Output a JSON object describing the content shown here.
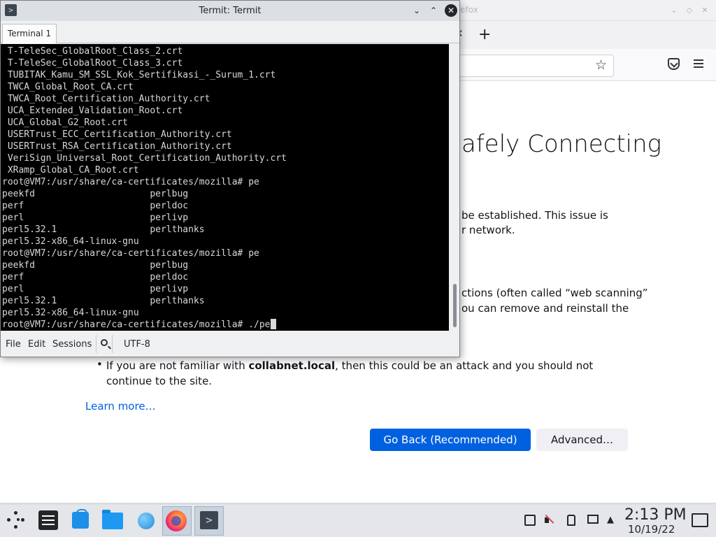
{
  "firefox": {
    "title_fragment": "efox",
    "error": {
      "title_fragment": "afely Connecting",
      "line1_fragment": "be established. This issue is",
      "line2_fragment": "r network.",
      "line3_fragment": "ctions (often called “web scanning”",
      "line4_fragment": "ou can remove and reinstall the",
      "bullet": "•",
      "bullet_pre": "If you are not familiar with ",
      "bullet_bold": "collabnet.local",
      "bullet_post": ", then this could be an attack and you should not continue to the site.",
      "learn_more": "Learn more…",
      "go_back": "Go Back (Recommended)",
      "advanced": "Advanced…"
    }
  },
  "termit": {
    "title": "Termit: Termit",
    "tab": "Terminal 1",
    "lines": [
      " T-TeleSec_GlobalRoot_Class_2.crt",
      " T-TeleSec_GlobalRoot_Class_3.crt",
      " TUBITAK_Kamu_SM_SSL_Kok_Sertifikasi_-_Surum_1.crt",
      " TWCA_Global_Root_CA.crt",
      " TWCA_Root_Certification_Authority.crt",
      " UCA_Extended_Validation_Root.crt",
      " UCA_Global_G2_Root.crt",
      " USERTrust_ECC_Certification_Authority.crt",
      " USERTrust_RSA_Certification_Authority.crt",
      " VeriSign_Universal_Root_Certification_Authority.crt",
      " XRamp_Global_CA_Root.crt",
      "root@VM7:/usr/share/ca-certificates/mozilla# pe",
      "peekfd                     perlbug",
      "perf                       perldoc",
      "perl                       perlivp",
      "perl5.32.1                 perlthanks",
      "perl5.32-x86_64-linux-gnu",
      "root@VM7:/usr/share/ca-certificates/mozilla# pe",
      "peekfd                     perlbug",
      "perf                       perldoc",
      "perl                       perlivp",
      "perl5.32.1                 perlthanks",
      "perl5.32-x86_64-linux-gnu",
      "root@VM7:/usr/share/ca-certificates/mozilla# ./pe"
    ],
    "menu": {
      "file": "File",
      "edit": "Edit",
      "sessions": "Sessions",
      "encoding": "UTF-8"
    }
  },
  "taskbar": {
    "time": "2:13 PM",
    "date": "10/19/22"
  }
}
